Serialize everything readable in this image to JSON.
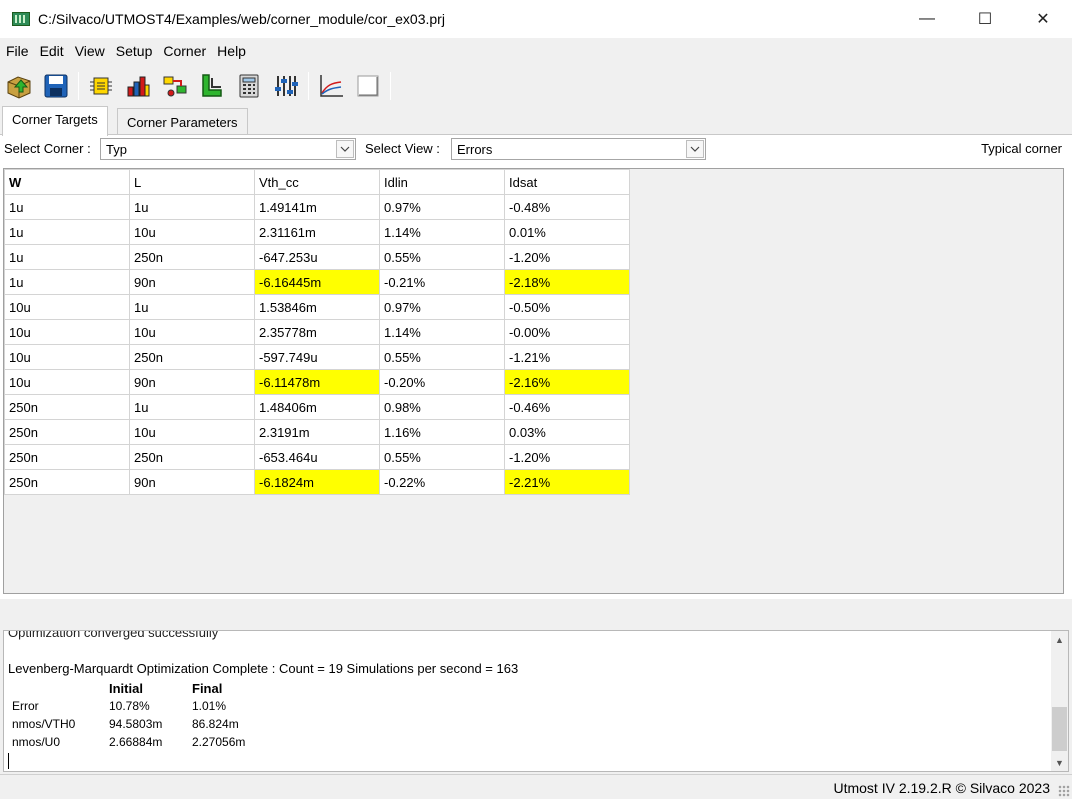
{
  "window": {
    "title": "C:/Silvaco/UTMOST4/Examples/web/corner_module/cor_ex03.prj",
    "minimize": "—",
    "maximize": "☐",
    "close": "✕"
  },
  "menu": [
    "File",
    "Edit",
    "View",
    "Setup",
    "Corner",
    "Help"
  ],
  "toolbar": {
    "icons": [
      "open-project-icon",
      "save-icon",
      "module-icon",
      "bar-chart-icon",
      "flow-icon",
      "layout-icon",
      "calculator-icon",
      "sliders-icon",
      "plot-icon",
      "blank-page-icon"
    ]
  },
  "tabs": [
    "Corner Targets",
    "Corner Parameters"
  ],
  "filters": {
    "corner_label": "Select Corner :",
    "corner_value": "Typ",
    "view_label": "Select View :",
    "view_value": "Errors",
    "status": "Typical corner"
  },
  "grid": {
    "headers": [
      "W",
      "L",
      "Vth_cc",
      "Idlin",
      "Idsat"
    ],
    "rows": [
      [
        "1u",
        "1u",
        "1.49141m",
        " 0.97%",
        "-0.48%"
      ],
      [
        "1u",
        "10u",
        "2.31161m",
        " 1.14%",
        " 0.01%"
      ],
      [
        "1u",
        "250n",
        "-647.253u",
        " 0.55%",
        "-1.20%"
      ],
      [
        "1u",
        "90n",
        "-6.16445m",
        "-0.21%",
        "-2.18%"
      ],
      [
        "10u",
        "1u",
        "1.53846m",
        " 0.97%",
        "-0.50%"
      ],
      [
        "10u",
        "10u",
        "2.35778m",
        " 1.14%",
        "-0.00%"
      ],
      [
        "10u",
        "250n",
        "-597.749u",
        " 0.55%",
        "-1.21%"
      ],
      [
        "10u",
        "90n",
        "-6.11478m",
        "-0.20%",
        "-2.16%"
      ],
      [
        "250n",
        "1u",
        "1.48406m",
        " 0.98%",
        "-0.46%"
      ],
      [
        "250n",
        "10u",
        "2.3191m",
        " 1.16%",
        " 0.03%"
      ],
      [
        "250n",
        "250n",
        "-653.464u",
        " 0.55%",
        "-1.20%"
      ],
      [
        "250n",
        "90n",
        "-6.1824m",
        "-0.22%",
        "-2.21%"
      ]
    ],
    "highlight_color": "#ffff00"
  },
  "log": {
    "partial_line": "Optimization converged successfully",
    "summary": "Levenberg-Marquardt Optimization Complete : Count = 19  Simulations per second = 163",
    "table": {
      "headers": [
        "",
        "Initial",
        "Final"
      ],
      "rows": [
        [
          "Error",
          "10.78%",
          "1.01%"
        ],
        [
          "nmos/VTH0",
          "94.5803m",
          "86.824m"
        ],
        [
          "nmos/U0",
          "2.66884m",
          "2.27056m"
        ]
      ]
    }
  },
  "statusbar": {
    "text": "Utmost IV 2.19.2.R © Silvaco 2023"
  }
}
